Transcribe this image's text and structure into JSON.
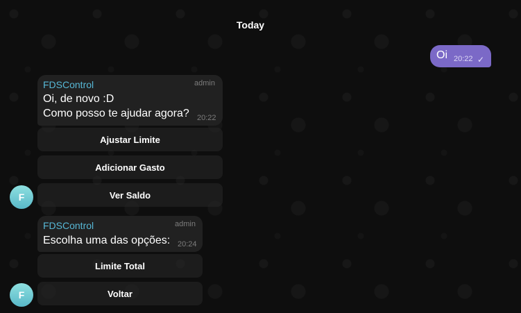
{
  "chat": {
    "date_label": "Today",
    "outgoing": {
      "text": "Oi",
      "time": "20:22",
      "status_icon": "check-icon"
    },
    "messages": [
      {
        "sender": "FDSControl",
        "badge": "admin",
        "lines": [
          "Oi, de novo :D",
          "Como posso te ajudar agora?"
        ],
        "time": "20:22",
        "buttons": [
          "Ajustar Limite",
          "Adicionar Gasto",
          "Ver Saldo"
        ],
        "avatar_letter": "F"
      },
      {
        "sender": "FDSControl",
        "badge": "admin",
        "lines": [
          "Escolha uma das opções:"
        ],
        "time": "20:24",
        "buttons": [
          "Limite Total",
          "Voltar"
        ],
        "avatar_letter": "F"
      }
    ]
  },
  "colors": {
    "background": "#0e0e0e",
    "outgoing_bubble": "#7b69c7",
    "incoming_bubble": "#212121",
    "sender_name": "#57b8d6",
    "avatar_gradient": [
      "#8ee0e0",
      "#59b8c8"
    ]
  }
}
